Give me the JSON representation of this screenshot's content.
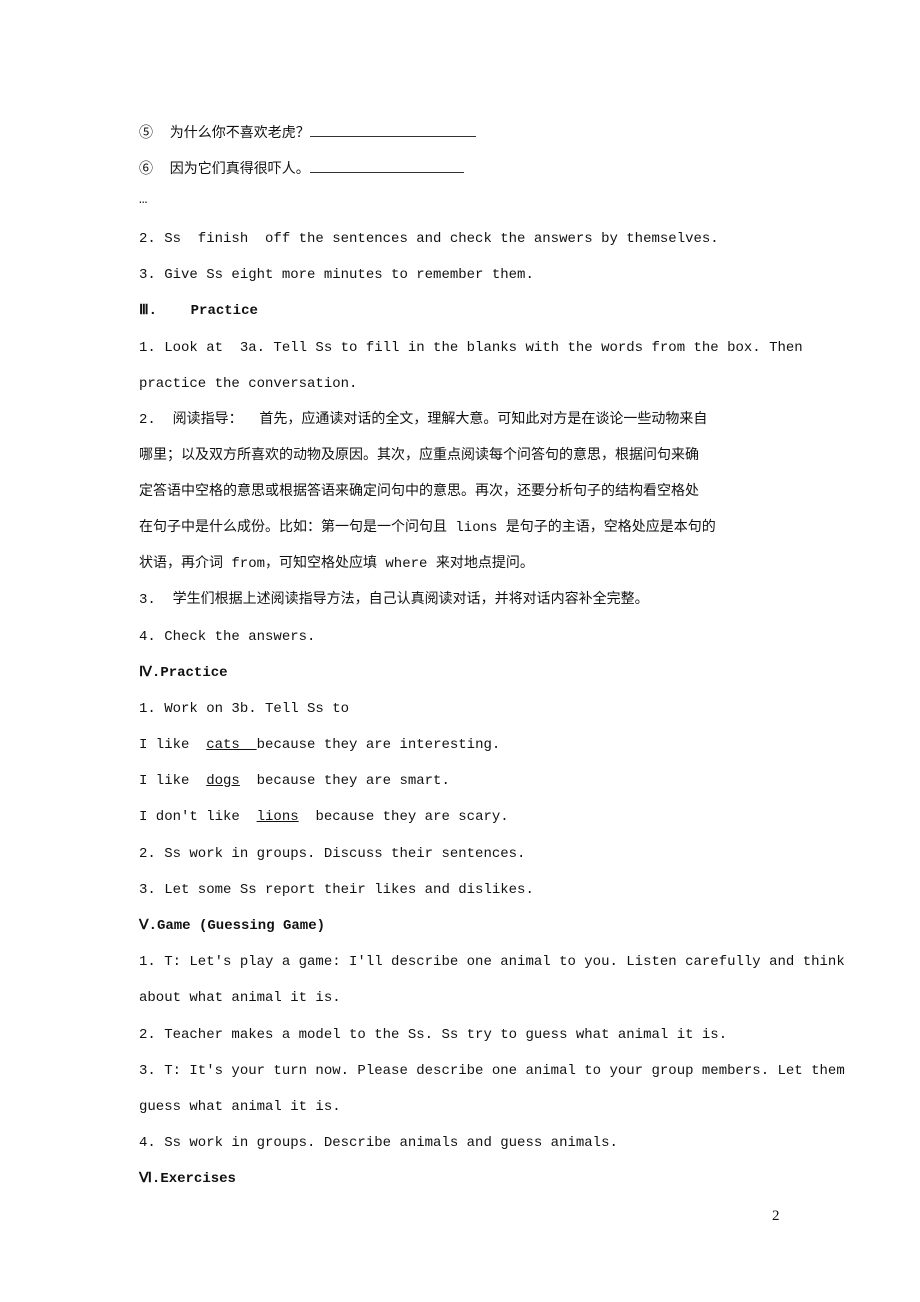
{
  "lines": [
    {
      "segs": [
        {
          "t": "⑤  为什么你不喜欢老虎？"
        },
        {
          "blank": 166
        }
      ]
    },
    {
      "segs": [
        {
          "t": "⑥  因为它们真得很吓人。"
        },
        {
          "blank": 154
        }
      ]
    },
    {
      "segs": [
        {
          "t": "…"
        }
      ]
    },
    {
      "segs": [
        {
          "t": "2. Ss  finish  off the sentences and check the answers by themselves."
        }
      ]
    },
    {
      "segs": [
        {
          "t": "3. Give Ss eight more minutes to remember them."
        }
      ]
    },
    {
      "h": true,
      "segs": [
        {
          "t": "Ⅲ.    Practice"
        }
      ]
    },
    {
      "segs": [
        {
          "t": "1. Look at  3a. Tell Ss to fill in the blanks with the words from the box. Then"
        }
      ]
    },
    {
      "segs": [
        {
          "t": "practice the conversation."
        }
      ]
    },
    {
      "segs": [
        {
          "t": "2.  阅读指导：  首先，应通读对话的全文，理解大意。可知此对方是在谈论一些动物来自"
        }
      ]
    },
    {
      "segs": [
        {
          "t": "哪里；以及双方所喜欢的动物及原因。其次，应重点阅读每个问答句的意思，根据问句来确"
        }
      ]
    },
    {
      "segs": [
        {
          "t": "定答语中空格的意思或根据答语来确定问句中的意思。再次，还要分析句子的结构看空格处"
        }
      ]
    },
    {
      "segs": [
        {
          "t": "在句子中是什么成份。比如：第一句是一个问句且 lions 是句子的主语，空格处应是本句的"
        }
      ]
    },
    {
      "segs": [
        {
          "t": "状语，再介词 from，可知空格处应填 where 来对地点提问。"
        }
      ]
    },
    {
      "segs": [
        {
          "t": "3.  学生们根据上述阅读指导方法，自己认真阅读对话，并将对话内容补全完整。"
        }
      ]
    },
    {
      "segs": [
        {
          "t": "4. Check the answers."
        }
      ]
    },
    {
      "h": true,
      "segs": [
        {
          "t": "Ⅳ.Practice"
        }
      ]
    },
    {
      "segs": [
        {
          "t": "1. Work on 3b. Tell Ss to"
        }
      ]
    },
    {
      "segs": [
        {
          "t": "I like  "
        },
        {
          "t": "cats  ",
          "u": true
        },
        {
          "t": "because they are interesting."
        }
      ]
    },
    {
      "segs": [
        {
          "t": "I like  "
        },
        {
          "t": "dogs",
          "u": true
        },
        {
          "t": "  because they are smart."
        }
      ]
    },
    {
      "segs": [
        {
          "t": "I don't like  "
        },
        {
          "t": "lions",
          "u": true
        },
        {
          "t": "  because they are scary."
        }
      ]
    },
    {
      "segs": [
        {
          "t": "2. Ss work in groups. Discuss their sentences."
        }
      ]
    },
    {
      "segs": [
        {
          "t": "3. Let some Ss report their likes and dislikes."
        }
      ]
    },
    {
      "h": true,
      "segs": [
        {
          "t": "Ⅴ.Game (Guessing Game)"
        }
      ]
    },
    {
      "segs": [
        {
          "t": "1. T: Let's play a game: I'll describe one animal to you. Listen carefully and think"
        }
      ]
    },
    {
      "segs": [
        {
          "t": "about what animal it is."
        }
      ]
    },
    {
      "segs": [
        {
          "t": "2. Teacher makes a model to the Ss. Ss try to guess what animal it is."
        }
      ]
    },
    {
      "segs": [
        {
          "t": "3. T: It's your turn now. Please describe one animal to your group members. Let them"
        }
      ]
    },
    {
      "segs": [
        {
          "t": "guess what animal it is."
        }
      ]
    },
    {
      "segs": [
        {
          "t": "4. Ss work in groups. Describe animals and guess animals."
        }
      ]
    },
    {
      "h": true,
      "segs": [
        {
          "t": "Ⅵ.Exercises"
        }
      ]
    }
  ],
  "page_number": "2"
}
